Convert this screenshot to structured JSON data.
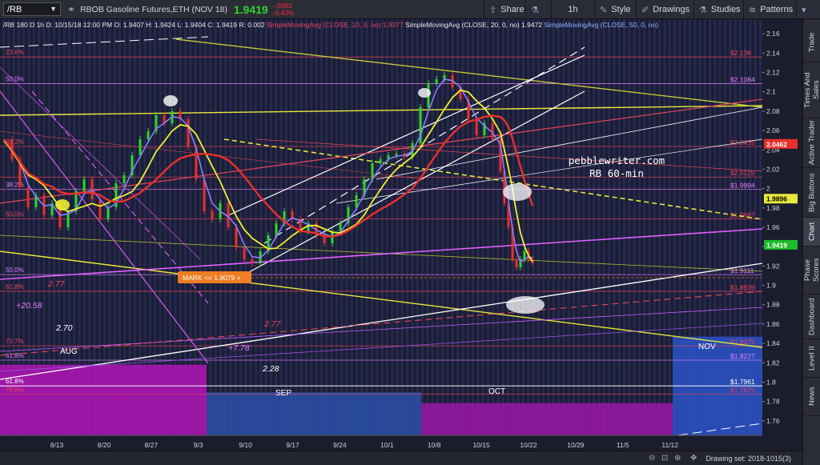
{
  "toolbar": {
    "symbol": "/RB",
    "description": "RBOB Gasoline Futures,ETH (NOV 18)",
    "last_price": "1.9419",
    "change_abs": "-.0083",
    "change_pct": "-0.43%",
    "share": "Share",
    "interval": "1h",
    "style": "Style",
    "drawings": "Drawings",
    "studies": "Studies",
    "patterns": "Patterns"
  },
  "header": {
    "info": "/RB 180 D 1h   D: 10/15/18 12:00 PM   O: 1.9407   H: 1.9424   L: 1.9404   C: 1.9419   R: 0.002",
    "sma10": "SimpleMovingAvg (CLOSE, 10, 0, no)  1.9377",
    "sma20": "SimpleMovingAvg (CLOSE, 20, 0, no)  1.9472",
    "sma50": "SimpleMovingAvg (CLOSE, 50, 0, no)"
  },
  "sidebar": {
    "tabs": [
      "Trade",
      "Times And Sales",
      "Active Trader",
      "Big Buttons",
      "Chart",
      "Phase Scores",
      "Dashboard",
      "Level II",
      "News"
    ],
    "active": "Chart"
  },
  "bottom": {
    "drawing_set": "Drawing set: 2018-1015(3)"
  },
  "chart_data": {
    "type": "candlestick",
    "watermark": "pebblewriter.com\nRB 60-min",
    "watermark_line1": "pebblewriter.com",
    "watermark_line2": "RB 60-min",
    "ylim": [
      1.745,
      2.175
    ],
    "y_ticks": [
      "2.16",
      "2.14",
      "2.12",
      "2.1",
      "2.08",
      "2.06",
      "2.04",
      "2.02",
      "2",
      "1.98",
      "1.96",
      "1.94",
      "1.92",
      "1.9",
      "1.88",
      "1.86",
      "1.84",
      "1.82",
      "1.8",
      "1.78",
      "1.76"
    ],
    "x_ticks": [
      "8/13",
      "8/20",
      "8/27",
      "9/3",
      "9/10",
      "9/17",
      "9/24",
      "10/1",
      "10/8",
      "10/15",
      "10/22",
      "10/29",
      "11/5",
      "11/12"
    ],
    "month_labels": [
      "AUG",
      "SEP",
      "OCT",
      "NOV"
    ],
    "price_tags": [
      {
        "label": "2.136",
        "color": "#e8455a",
        "value": 2.136
      },
      {
        "label": "2.1084",
        "color": "#e080ff",
        "value": 2.1084
      },
      {
        "label": "2.0435",
        "color": "#e8455a",
        "value": 2.0435
      },
      {
        "label": "2.0119",
        "color": "#e8455a",
        "value": 2.0119
      },
      {
        "label": "1.9994",
        "color": "#e080ff",
        "value": 1.9994
      },
      {
        "label": "1.9687",
        "color": "#e8455a",
        "value": 1.9687
      },
      {
        "label": "1.9111",
        "color": "#e080ff",
        "value": 1.9111
      },
      {
        "label": "1.8939",
        "color": "#e8455a",
        "value": 1.8939
      },
      {
        "label": "1.8375",
        "color": "#e8455a",
        "value": 1.8375
      },
      {
        "label": "1.8227",
        "color": "#e080ff",
        "value": 1.8227
      },
      {
        "label": "1.7961",
        "color": "#ffffff",
        "value": 1.7961
      },
      {
        "label": "1.7875",
        "color": "#e8455a",
        "value": 1.7875
      }
    ],
    "axis_badges": [
      {
        "label": "2.0462",
        "color": "#e8302b",
        "value": 2.0462
      },
      {
        "label": "1.9896",
        "color": "#e8e83a",
        "value": 1.9896
      },
      {
        "label": "1.9419",
        "color": "#1fbb2a",
        "value": 1.9419
      }
    ],
    "left_fib_labels": [
      {
        "label": "23.6%",
        "value": 2.136,
        "color": "#e8455a"
      },
      {
        "label": "50.0%",
        "value": 2.1084,
        "color": "#e080ff"
      },
      {
        "label": "38.2%",
        "value": 2.0435,
        "color": "#e8455a"
      },
      {
        "label": "38.2%",
        "value": 1.9994,
        "color": "#e080ff"
      },
      {
        "label": "50.0%",
        "value": 1.9687,
        "color": "#e8455a"
      },
      {
        "label": "50.0%",
        "value": 1.9111,
        "color": "#e080ff"
      },
      {
        "label": "61.8%",
        "value": 1.8939,
        "color": "#e8455a"
      },
      {
        "label": "70.7%",
        "value": 1.8375,
        "color": "#e8455a"
      },
      {
        "label": "61.8%",
        "value": 1.8227,
        "color": "#e080ff"
      },
      {
        "label": "61.8%",
        "value": 1.7961,
        "color": "#ffffff"
      },
      {
        "label": "78.6%",
        "value": 1.7875,
        "color": "#e8455a"
      }
    ],
    "annotations": [
      {
        "text": "2.77",
        "color": "#e8455a"
      },
      {
        "text": "+20.58",
        "color": "#e080ff"
      },
      {
        "text": "2.70",
        "color": "#ffffff"
      },
      {
        "text": "2.77",
        "color": "#e8455a"
      },
      {
        "text": "+7.78",
        "color": "#e080ff"
      },
      {
        "text": "2.28",
        "color": "#ffffff"
      }
    ],
    "mark_label": "MARK <= 1.9079 ×",
    "mark_value": 1.9079
  }
}
